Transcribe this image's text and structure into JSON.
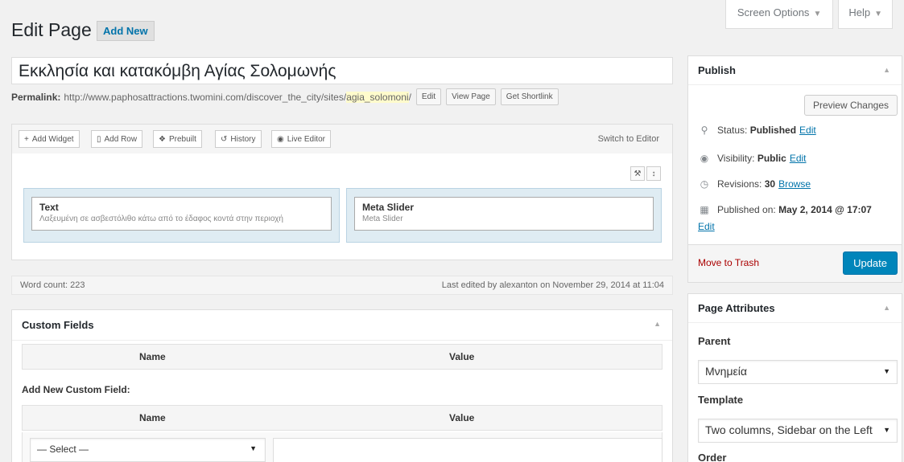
{
  "header": {
    "title": "Edit Page",
    "add_new": "Add New",
    "screen_options": "Screen Options",
    "help": "Help"
  },
  "post": {
    "title": "Εκκλησία και κατακόμβη Αγίας Σολομωνής",
    "permalink_label": "Permalink:",
    "permalink_base": "http://www.paphosattractions.twomini.com/discover_the_city/sites/",
    "permalink_slug": "agia_solomoni",
    "permalink_end": "/",
    "edit_btn": "Edit",
    "view_btn": "View Page",
    "shortlink_btn": "Get Shortlink"
  },
  "page_builder": {
    "buttons": [
      "Add Widget",
      "Add Row",
      "Prebuilt",
      "History",
      "Live Editor"
    ],
    "switch_editor": "Switch to Editor",
    "widgets": [
      {
        "title": "Text",
        "desc": "Λαξευμένη σε ασβεστόλιθο κάτω από το έδαφος κοντά στην περιοχή"
      },
      {
        "title": "Meta Slider",
        "desc": "Meta Slider"
      }
    ]
  },
  "status_bar": {
    "word_count": "Word count: 223",
    "last_edited": "Last edited by alexanton on November 29, 2014 at 11:04"
  },
  "custom_fields": {
    "title": "Custom Fields",
    "name_col": "Name",
    "value_col": "Value",
    "add_new_label": "Add New Custom Field:",
    "select_value": "— Select —"
  },
  "publish": {
    "title": "Publish",
    "preview": "Preview Changes",
    "status_label": "Status:",
    "status_value": "Published",
    "status_edit": "Edit",
    "visibility_label": "Visibility:",
    "visibility_value": "Public",
    "visibility_edit": "Edit",
    "revisions_label": "Revisions:",
    "revisions_value": "30",
    "revisions_browse": "Browse",
    "published_label": "Published on:",
    "published_value": "May 2, 2014 @ 17:07",
    "published_edit": "Edit",
    "trash": "Move to Trash",
    "update": "Update"
  },
  "page_attributes": {
    "title": "Page Attributes",
    "parent_label": "Parent",
    "parent_value": "Μνημεία",
    "template_label": "Template",
    "template_value": "Two columns, Sidebar on the Left",
    "order_label": "Order"
  },
  "colors": {
    "primary_button": "#0085ba",
    "link": "#0073aa",
    "trash": "#a00",
    "cell_bg": "#dfecf3"
  }
}
